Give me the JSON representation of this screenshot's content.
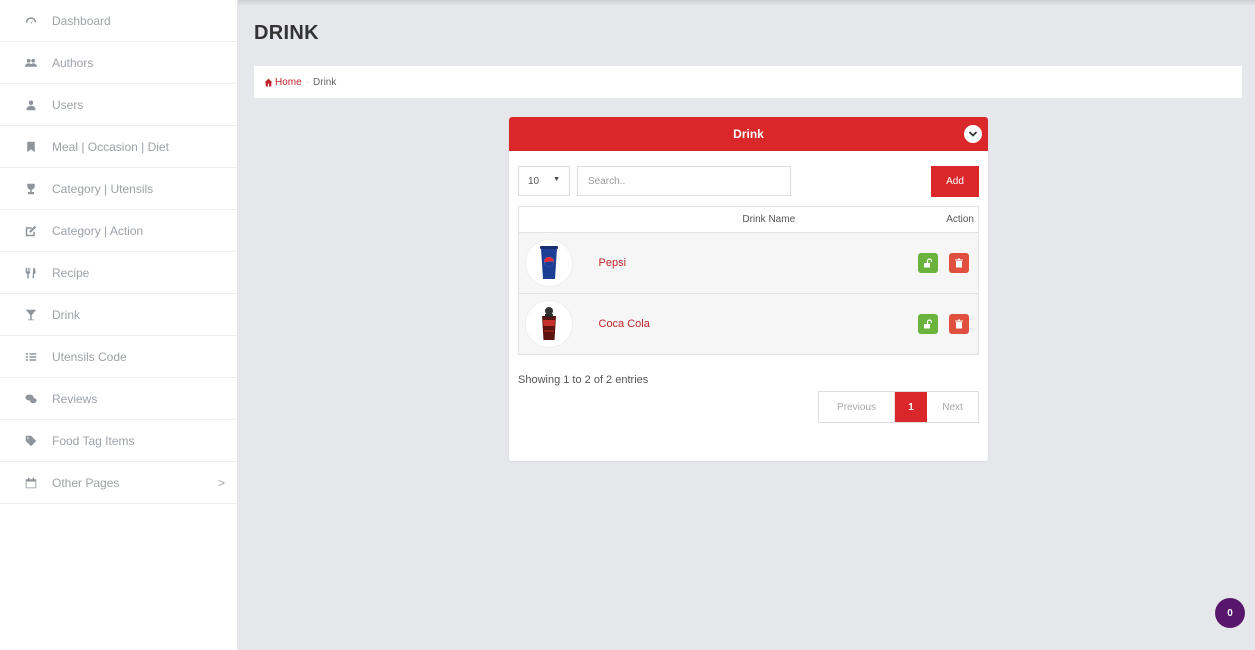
{
  "sidebar": {
    "items": [
      {
        "label": "Dashboard",
        "icon": "dashboard-icon"
      },
      {
        "label": "Authors",
        "icon": "users-group-icon"
      },
      {
        "label": "Users",
        "icon": "user-icon"
      },
      {
        "label": "Meal | Occasion | Diet",
        "icon": "bookmark-icon"
      },
      {
        "label": "Category | Utensils",
        "icon": "trophy-icon"
      },
      {
        "label": "Category | Action",
        "icon": "edit-icon"
      },
      {
        "label": "Recipe",
        "icon": "cutlery-icon"
      },
      {
        "label": "Drink",
        "icon": "glass-icon"
      },
      {
        "label": "Utensils Code",
        "icon": "list-icon"
      },
      {
        "label": "Reviews",
        "icon": "comments-icon"
      },
      {
        "label": "Food Tag Items",
        "icon": "tag-icon"
      },
      {
        "label": "Other Pages",
        "icon": "calendar-icon",
        "chevron": ">"
      }
    ]
  },
  "header": {
    "title": "DRINK"
  },
  "breadcrumb": {
    "home": "Home",
    "current": "Drink"
  },
  "panel": {
    "title": "Drink",
    "page_length": "10",
    "search_placeholder": "Search..",
    "add_label": "Add",
    "columns": {
      "name": "Drink Name",
      "action": "Action"
    },
    "rows": [
      {
        "name": "Pepsi",
        "thumb": "pepsi-cup-image"
      },
      {
        "name": "Coca Cola",
        "thumb": "coca-cola-glass-image"
      }
    ],
    "info": "Showing 1 to 2 of 2 entries",
    "pagination": {
      "previous": "Previous",
      "current": "1",
      "next": "Next"
    }
  },
  "notification": {
    "count": "0"
  },
  "colors": {
    "accent": "#d9272a",
    "edit": "#6ab43e",
    "delete": "#e1503f",
    "badge": "#59176b"
  }
}
